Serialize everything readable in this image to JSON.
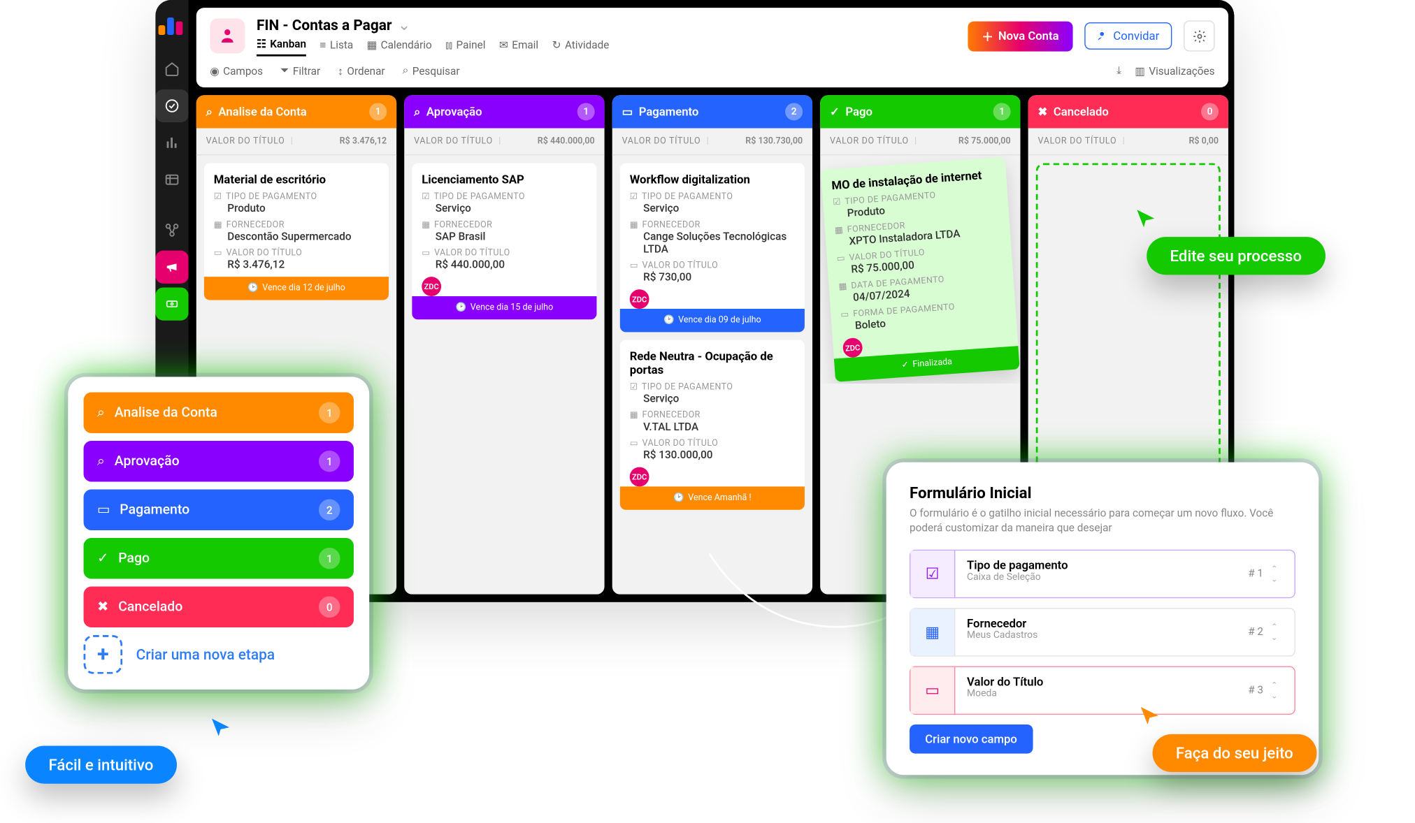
{
  "header": {
    "title": "FIN - Contas a Pagar",
    "views": [
      "Kanban",
      "Lista",
      "Calendário",
      "Painel",
      "Email",
      "Atividade"
    ],
    "nova_conta": "Nova Conta",
    "convidar": "Convidar",
    "tools": {
      "campos": "Campos",
      "filtrar": "Filtrar",
      "ordenar": "Ordenar",
      "pesquisar": "Pesquisar",
      "visualizacoes": "Visualizações"
    }
  },
  "sum_label": "VALOR DO TÍTULO",
  "columns": [
    {
      "key": "analise",
      "title": "Analise da Conta",
      "count": 1,
      "color": "#ff8a00",
      "sum": "R$ 3.476,12"
    },
    {
      "key": "aprov",
      "title": "Aprovação",
      "count": 1,
      "color": "#8a00ff",
      "sum": "R$ 440.000,00"
    },
    {
      "key": "pag",
      "title": "Pagamento",
      "count": 2,
      "color": "#2563ff",
      "sum": "R$ 130.730,00"
    },
    {
      "key": "pago",
      "title": "Pago",
      "count": 1,
      "color": "#14c900",
      "sum": "R$ 75.000,00"
    },
    {
      "key": "canc",
      "title": "Cancelado",
      "count": 0,
      "color": "#ff2d55",
      "sum": "R$ 0,00"
    }
  ],
  "cards": {
    "analise": {
      "title": "Material de escritório",
      "tipo_l": "TIPO DE PAGAMENTO",
      "tipo": "Produto",
      "forn_l": "FORNECEDOR",
      "forn": "Descontão Supermercado",
      "valor_l": "VALOR DO TÍTULO",
      "valor": "R$ 3.476,12",
      "av": "",
      "due": "Vence dia 12 de julho"
    },
    "aprov": {
      "title": "Licenciamento SAP",
      "tipo_l": "TIPO DE PAGAMENTO",
      "tipo": "Serviço",
      "forn_l": "FORNECEDOR",
      "forn": "SAP Brasil",
      "valor_l": "VALOR DO TÍTULO",
      "valor": "R$ 440.000,00",
      "av": "ZDC",
      "due": "Vence dia 15 de julho"
    },
    "pag1": {
      "title": "Workflow digitalization",
      "tipo_l": "TIPO DE PAGAMENTO",
      "tipo": "Serviço",
      "forn_l": "FORNECEDOR",
      "forn": "Cange Soluções Tecnológicas LTDA",
      "valor_l": "VALOR DO TÍTULO",
      "valor": "R$ 730,00",
      "av": "ZDC",
      "due": "Vence dia 09 de julho"
    },
    "pag2": {
      "title": "Rede Neutra - Ocupação de portas",
      "tipo_l": "TIPO DE PAGAMENTO",
      "tipo": "Serviço",
      "forn_l": "FORNECEDOR",
      "forn": "V.TAL LTDA",
      "valor_l": "VALOR DO TÍTULO",
      "valor": "R$ 130.000,00",
      "av": "ZDC",
      "due": "Vence Amanhã !"
    },
    "pago": {
      "title": "MO de instalação de internet",
      "tipo_l": "TIPO DE PAGAMENTO",
      "tipo": "Produto",
      "forn_l": "FORNECEDOR",
      "forn": "XPTO Instaladora LTDA",
      "valor_l": "VALOR DO TÍTULO",
      "valor": "R$ 75.000,00",
      "data_l": "DATA DE PAGAMENTO",
      "data": "04/07/2024",
      "forma_l": "FORMA DE PAGAMENTO",
      "forma": "Boleto",
      "av": "ZDC",
      "done": "Finalizada"
    }
  },
  "stage_list": {
    "items": [
      {
        "title": "Analise da Conta",
        "count": 1,
        "color": "#ff8a00",
        "ico": "search"
      },
      {
        "title": "Aprovação",
        "count": 1,
        "color": "#8a00ff",
        "ico": "search"
      },
      {
        "title": "Pagamento",
        "count": 2,
        "color": "#2563ff",
        "ico": "card"
      },
      {
        "title": "Pago",
        "count": 1,
        "color": "#14c900",
        "ico": "check"
      },
      {
        "title": "Cancelado",
        "count": 0,
        "color": "#ff2d55",
        "ico": "x"
      }
    ],
    "new": "Criar uma nova etapa"
  },
  "form_panel": {
    "title": "Formulário Inicial",
    "desc": "O formulário é o gatilho inicial necessário para começar um novo fluxo. Você poderá customizar da maneira que desejar",
    "fields": [
      {
        "name": "Tipo de pagamento",
        "sub": "Caixa de Seleção",
        "idx": "# 1"
      },
      {
        "name": "Fornecedor",
        "sub": "Meus Cadastros",
        "idx": "# 2"
      },
      {
        "name": "Valor do Título",
        "sub": "Moeda",
        "idx": "# 3"
      }
    ],
    "btn": "Criar novo campo"
  },
  "chips": {
    "easy": "Fácil e intuitivo",
    "edit": "Edite seu processo",
    "own": "Faça do seu jeito"
  }
}
